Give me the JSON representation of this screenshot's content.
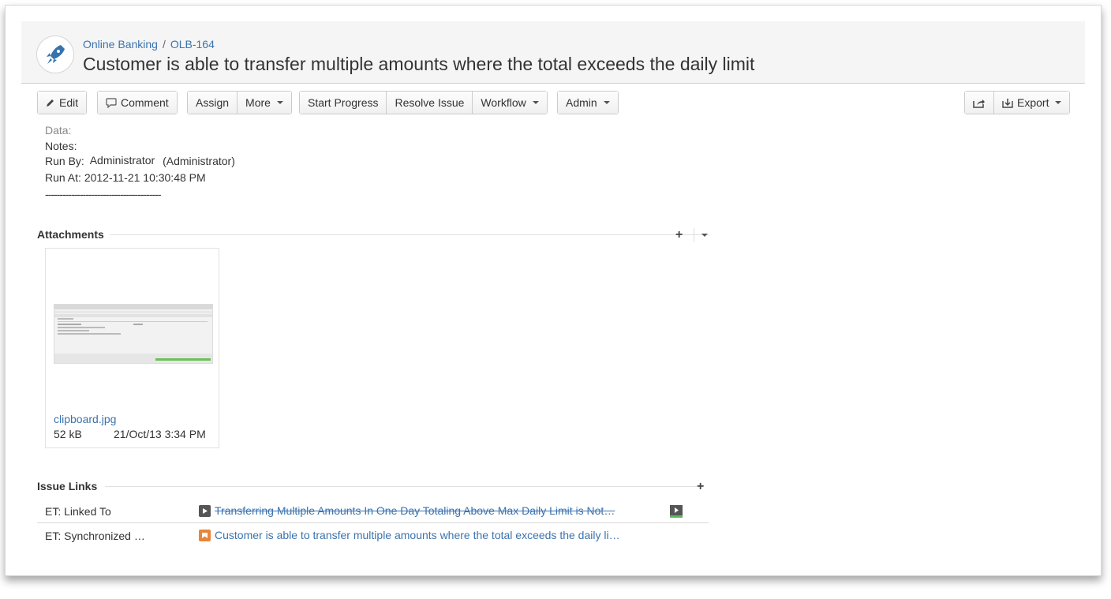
{
  "breadcrumb": {
    "project": "Online Banking",
    "separator": "/",
    "issue_key": "OLB-164"
  },
  "title": "Customer is able to transfer multiple amounts where the total exceeds the daily limit",
  "toolbar": {
    "edit": "Edit",
    "comment": "Comment",
    "assign": "Assign",
    "more": "More",
    "start_progress": "Start Progress",
    "resolve_issue": "Resolve Issue",
    "workflow": "Workflow",
    "admin": "Admin",
    "export": "Export"
  },
  "details": {
    "data_label": "Data:",
    "notes_label": "Notes:",
    "run_by_label": "Run By:",
    "run_by_value": "Administrator",
    "run_by_paren": "(Administrator)",
    "run_at_label": "Run At:",
    "run_at_value": "2012-11-21 10:30:48 PM",
    "divider": "----------------------------------------"
  },
  "attachments": {
    "title": "Attachments",
    "items": [
      {
        "name": "clipboard.jpg",
        "size": "52 kB",
        "date": "21/Oct/13 3:34 PM"
      }
    ]
  },
  "issue_links": {
    "title": "Issue Links",
    "rows": [
      {
        "type": "ET: Linked To",
        "text": "Transferring Multiple Amounts In One Day Totaling Above Max Daily Limit is Not…",
        "resolved": true
      },
      {
        "type": "ET: Synchronized …",
        "text": "Customer is able to transfer multiple amounts where the total exceeds the daily li…",
        "resolved": false
      }
    ]
  },
  "colors": {
    "link": "#3b73af",
    "rocket": "#3572b0",
    "bug_orange": "#e8853b",
    "test_gray": "#555555"
  }
}
